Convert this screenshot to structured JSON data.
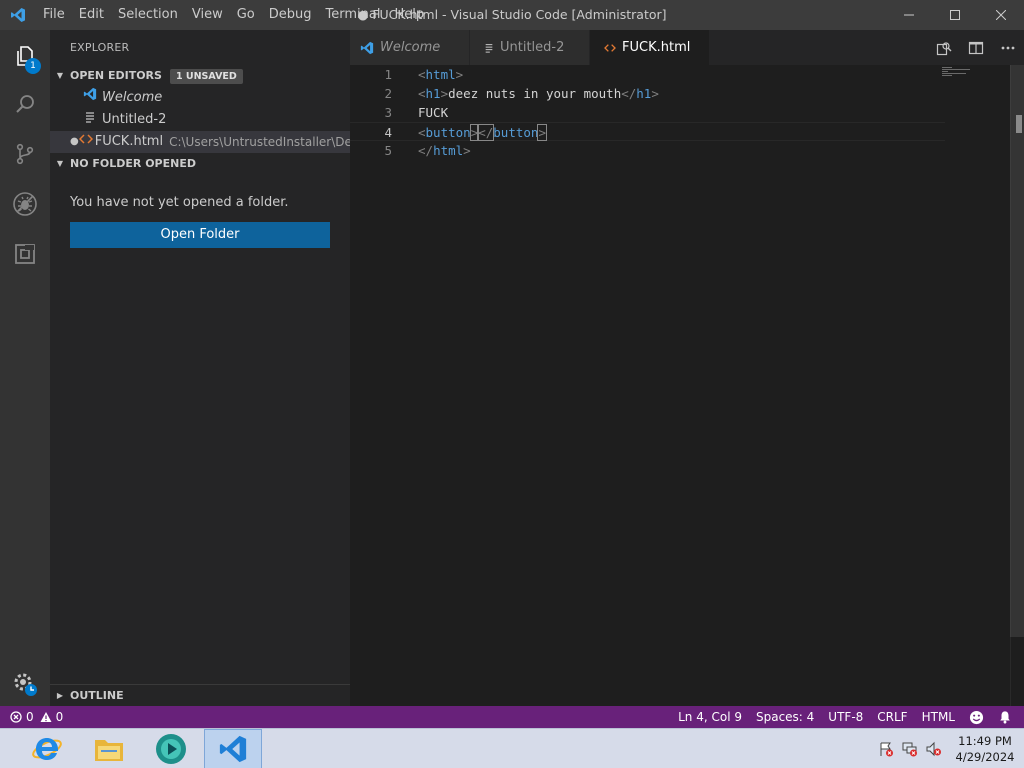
{
  "window": {
    "title": "● FUCK.html - Visual Studio Code [Administrator]"
  },
  "menu": [
    "File",
    "Edit",
    "Selection",
    "View",
    "Go",
    "Debug",
    "Terminal",
    "Help"
  ],
  "activity": {
    "explorer_badge": "1",
    "icons": [
      "files-icon",
      "search-icon",
      "source-control-icon",
      "debug-icon",
      "extensions-icon",
      "settings-gear-icon"
    ]
  },
  "sidebar": {
    "title": "EXPLORER",
    "open_editors": {
      "header": "OPEN EDITORS",
      "badge": "1 UNSAVED",
      "items": [
        {
          "name": "Welcome",
          "italic": true
        },
        {
          "name": "Untitled-2"
        },
        {
          "name": "FUCK.html",
          "path": "C:\\Users\\UntrustedInstaller\\Desk..."
        }
      ]
    },
    "no_folder": {
      "header": "NO FOLDER OPENED",
      "message": "You have not yet opened a folder.",
      "button": "Open Folder"
    },
    "outline": "OUTLINE"
  },
  "tabs": [
    {
      "label": "Welcome"
    },
    {
      "label": "Untitled-2"
    },
    {
      "label": "FUCK.html",
      "active": true,
      "dirty": true
    }
  ],
  "editor": {
    "line_numbers": [
      "1",
      "2",
      "3",
      "4",
      "5"
    ],
    "current_line": 4,
    "lines": {
      "l1_open": "<",
      "l1_tag": "html",
      "l1_close": ">",
      "l2_open": "<",
      "l2_tag": "h1",
      "l2_close": ">",
      "l2_text": "deez nuts in your mouth",
      "l2_end_open": "</",
      "l2_end_tag": "h1",
      "l2_end_close": ">",
      "l3_text": "FUCK",
      "l4_open": "<",
      "l4_tag": "button",
      "l4_close": ">",
      "l4_end_open": "</",
      "l4_end_tag": "button",
      "l4_end_close": ">",
      "l5_open": "</",
      "l5_tag": "html",
      "l5_close": ">"
    }
  },
  "statusbar": {
    "errors": "0",
    "warnings": "0",
    "position": "Ln 4, Col 9",
    "spaces": "Spaces: 4",
    "encoding": "UTF-8",
    "eol": "CRLF",
    "language": "HTML"
  },
  "taskbar": {
    "time": "11:49 PM",
    "date": "4/29/2024"
  },
  "colors": {
    "statusbar": "#68217a",
    "accent": "#007acc",
    "tag": "#569cd6"
  }
}
